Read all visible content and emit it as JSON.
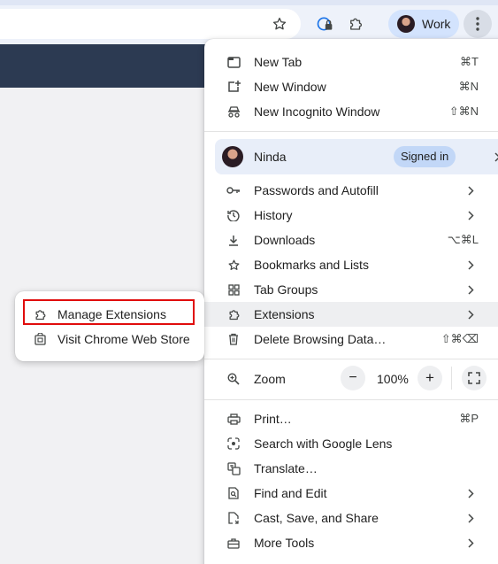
{
  "toolbar": {
    "profile_chip_label": "Work",
    "icons": [
      "star-icon",
      "password-manager-icon",
      "extensions-puzzle-icon",
      "more-vert-icon"
    ]
  },
  "menu": {
    "items_top": [
      {
        "label": "New Tab",
        "shortcut": "⌘T",
        "icon": "new-tab-icon"
      },
      {
        "label": "New Window",
        "shortcut": "⌘N",
        "icon": "new-window-icon"
      },
      {
        "label": "New Incognito Window",
        "shortcut": "⇧⌘N",
        "icon": "incognito-icon"
      }
    ],
    "profile": {
      "name": "Ninda",
      "badge": "Signed in"
    },
    "items_mid": [
      {
        "label": "Passwords and Autofill",
        "icon": "key-icon"
      },
      {
        "label": "History",
        "icon": "history-icon"
      },
      {
        "label": "Downloads",
        "shortcut": "⌥⌘L",
        "icon": "download-icon"
      },
      {
        "label": "Bookmarks and Lists",
        "icon": "star-icon"
      },
      {
        "label": "Tab Groups",
        "icon": "tab-groups-icon"
      },
      {
        "label": "Extensions",
        "icon": "extensions-puzzle-icon"
      },
      {
        "label": "Delete Browsing Data…",
        "shortcut": "⇧⌘⌫",
        "icon": "trash-icon"
      }
    ],
    "zoom": {
      "label": "Zoom",
      "value": "100%",
      "minus": "−",
      "plus": "+"
    },
    "items_bottom": [
      {
        "label": "Print…",
        "shortcut": "⌘P",
        "icon": "print-icon"
      },
      {
        "label": "Search with Google Lens",
        "icon": "lens-icon"
      },
      {
        "label": "Translate…",
        "icon": "translate-icon"
      },
      {
        "label": "Find and Edit",
        "icon": "find-icon"
      },
      {
        "label": "Cast, Save, and Share",
        "icon": "cast-icon"
      },
      {
        "label": "More Tools",
        "icon": "toolbox-icon"
      }
    ]
  },
  "submenu": {
    "items": [
      {
        "label": "Manage Extensions",
        "icon": "extensions-puzzle-icon"
      },
      {
        "label": "Visit Chrome Web Store",
        "icon": "web-store-icon"
      }
    ]
  },
  "colors": {
    "accent_chip": "#d3e3fd",
    "profile_row": "#e8eef9",
    "highlight_box": "#e00c0c",
    "page_header": "#2c3a52"
  }
}
